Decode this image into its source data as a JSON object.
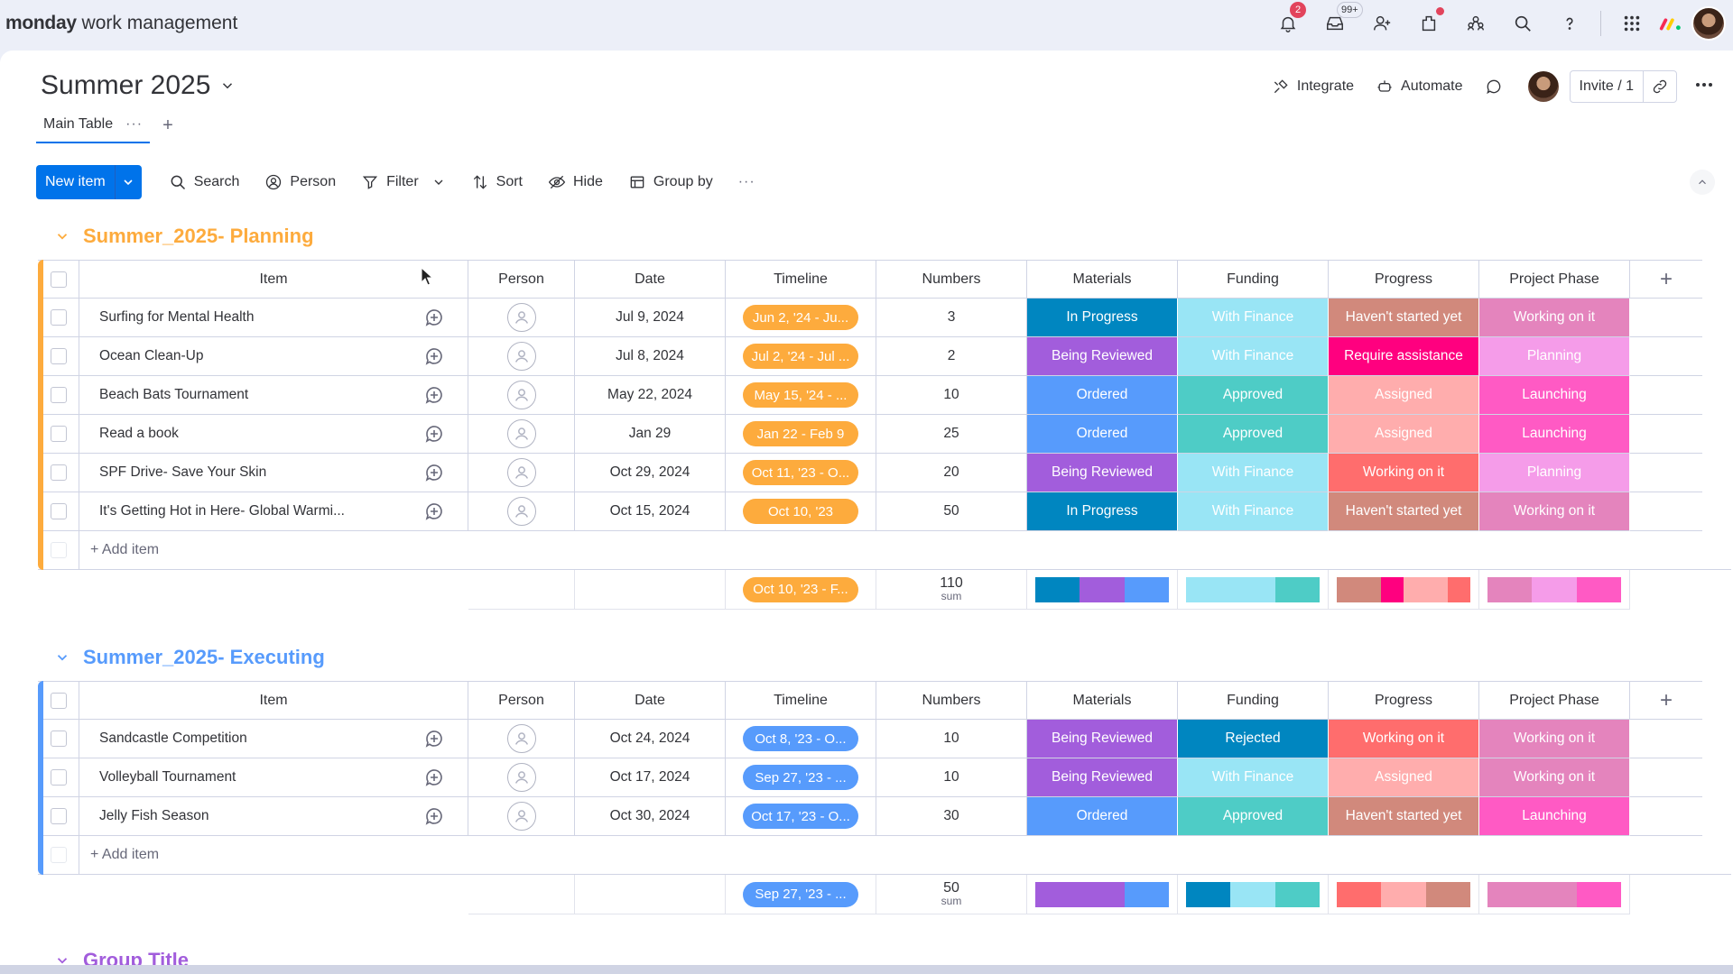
{
  "topbar": {
    "brand_bold": "monday",
    "brand_rest": " work management",
    "notif_badge": "2",
    "inbox_badge": "99+"
  },
  "board": {
    "title": "Summer 2025",
    "integrate": "Integrate",
    "automate": "Automate",
    "invite": "Invite / 1"
  },
  "tabs": {
    "main": "Main Table",
    "more": "···",
    "add": "+"
  },
  "toolbar": {
    "new_item": "New item",
    "search": "Search",
    "person": "Person",
    "filter": "Filter",
    "sort": "Sort",
    "hide": "Hide",
    "group_by": "Group by",
    "more": "···"
  },
  "columns": {
    "item": "Item",
    "person": "Person",
    "date": "Date",
    "timeline": "Timeline",
    "numbers": "Numbers",
    "materials": "Materials",
    "funding": "Funding",
    "progress": "Progress",
    "phase": "Project Phase"
  },
  "colors": {
    "in_progress": "#0086c0",
    "being_reviewed": "#a25ddc",
    "ordered": "#579bfc",
    "with_finance": "#99e5f5",
    "approved": "#4eccc6",
    "rejected": "#0086c0",
    "havent_started": "#d1897c",
    "require_assistance": "#ff007f",
    "assigned": "#ffadad",
    "working_progress": "#ff6d6d",
    "phase_working": "#e484bd",
    "phase_planning": "#f59ce9",
    "phase_launching": "#ff5ac4",
    "planning_accent": "#fdab3d",
    "executing_accent": "#579bfc"
  },
  "groups": [
    {
      "title": "Summer_2025- Planning",
      "add_item": "+ Add item",
      "rows": [
        {
          "name": "Surfing for Mental Health",
          "date": "Jul 9, 2024",
          "timeline": "Jun 2, '24 - Ju...",
          "number": "3",
          "materials": "In Progress",
          "funding": "With Finance",
          "progress": "Haven't started yet",
          "phase": "Working on it"
        },
        {
          "name": "Ocean Clean-Up",
          "date": "Jul 8, 2024",
          "timeline": "Jul 2, '24 - Jul ...",
          "number": "2",
          "materials": "Being Reviewed",
          "funding": "With Finance",
          "progress": "Require assistance",
          "phase": "Planning"
        },
        {
          "name": "Beach Bats Tournament",
          "date": "May 22, 2024",
          "timeline": "May 15, '24 - ...",
          "number": "10",
          "materials": "Ordered",
          "funding": "Approved",
          "progress": "Assigned",
          "phase": "Launching"
        },
        {
          "name": "Read a book",
          "date": "Jan 29",
          "timeline": "Jan 22 - Feb 9",
          "number": "25",
          "materials": "Ordered",
          "funding": "Approved",
          "progress": "Assigned",
          "phase": "Launching"
        },
        {
          "name": "SPF Drive- Save Your Skin",
          "date": "Oct 29, 2024",
          "timeline": "Oct 11, '23 - O...",
          "number": "20",
          "materials": "Being Reviewed",
          "funding": "With Finance",
          "progress": "Working on it",
          "phase": "Planning"
        },
        {
          "name": "It's Getting Hot in Here- Global Warmi...",
          "date": "Oct 15, 2024",
          "timeline": "Oct 10, '23",
          "number": "50",
          "materials": "In Progress",
          "funding": "With Finance",
          "progress": "Haven't started yet",
          "phase": "Working on it"
        }
      ],
      "summary": {
        "timeline": "Oct 10, '23 - F...",
        "sum": "110",
        "sum_label": "sum"
      }
    },
    {
      "title": "Summer_2025- Executing",
      "add_item": "+ Add item",
      "rows": [
        {
          "name": "Sandcastle Competition",
          "date": "Oct 24, 2024",
          "timeline": "Oct 8, '23 - O...",
          "number": "10",
          "materials": "Being Reviewed",
          "funding": "Rejected",
          "progress": "Working on it",
          "phase": "Working on it"
        },
        {
          "name": "Volleyball Tournament",
          "date": "Oct 17, 2024",
          "timeline": "Sep 27, '23 - ...",
          "number": "10",
          "materials": "Being Reviewed",
          "funding": "With Finance",
          "progress": "Assigned",
          "phase": "Working on it"
        },
        {
          "name": "Jelly Fish Season",
          "date": "Oct 30, 2024",
          "timeline": "Oct 17, '23 - O...",
          "number": "30",
          "materials": "Ordered",
          "funding": "Approved",
          "progress": "Haven't started yet",
          "phase": "Launching"
        }
      ],
      "summary": {
        "timeline": "Sep 27, '23 - ...",
        "sum": "50",
        "sum_label": "sum"
      }
    }
  ],
  "next_group_title": "Group Title"
}
